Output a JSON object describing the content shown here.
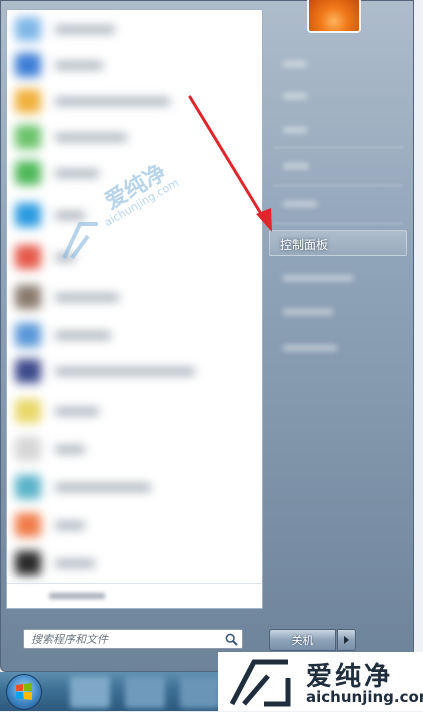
{
  "start_menu": {
    "right_items": {
      "control_panel": "控制面板"
    },
    "search": {
      "placeholder": "搜索程序和文件",
      "icon": "search-icon"
    },
    "shutdown": {
      "label": "关机",
      "arrow_icon": "triangle-right-icon"
    }
  },
  "watermark": {
    "cn": "爱纯净",
    "en": "aichunjing.com",
    "color": "#7fb2dc"
  },
  "colors": {
    "annotation_arrow": "#e0262b",
    "menu_frame": "#6d8399",
    "taskbar": "#3d6f95"
  }
}
